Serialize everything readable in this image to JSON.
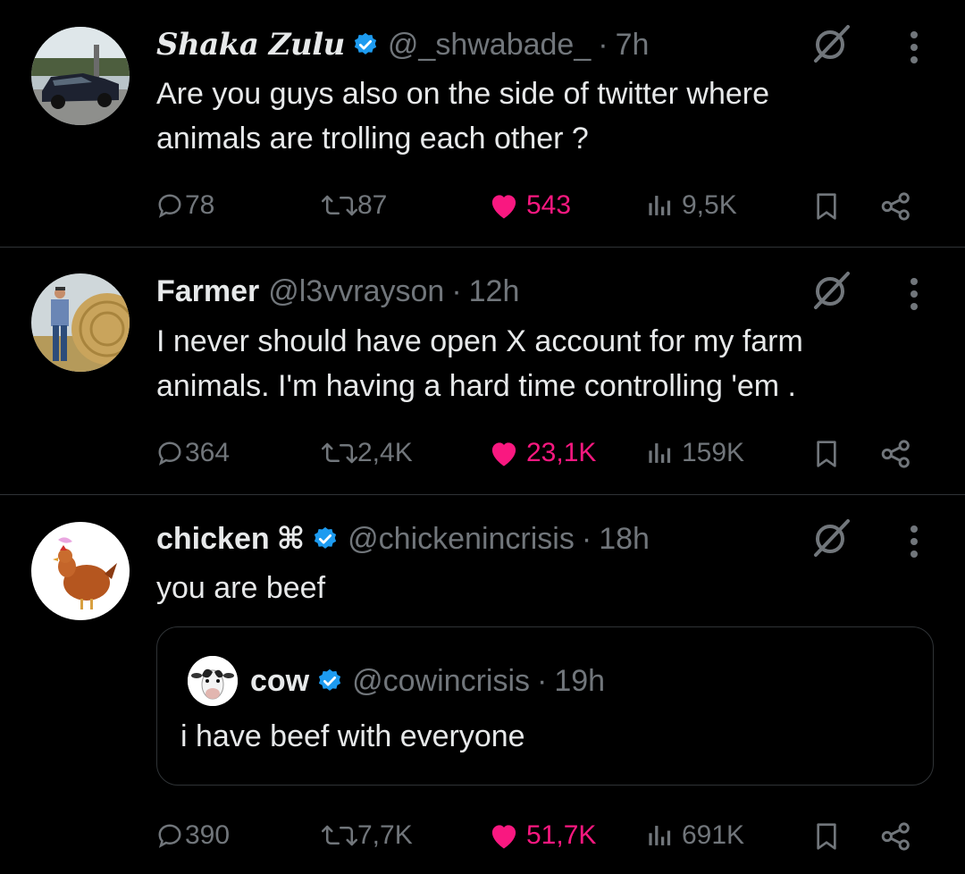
{
  "colors": {
    "background": "#000000",
    "text": "#e7e9ea",
    "muted": "#71767b",
    "like": "#f91880",
    "verified": "#1d9bf0",
    "divider": "#2f3336"
  },
  "tweets": [
    {
      "name": "Shaka Zulu",
      "verified": true,
      "handle": "@_shwabade_",
      "time": "7h",
      "text_lines": [
        "Are you guys also on the side of twitter where",
        "animals are trolling each other ?"
      ],
      "replies": "78",
      "reposts": "87",
      "likes": "543",
      "liked": true,
      "views": "9,5K",
      "avatar_icon": "car-avatar-icon"
    },
    {
      "name": "Farmer",
      "verified": false,
      "handle": "@l3vvrayson",
      "time": "12h",
      "text_lines": [
        "I never should have open X account for my farm",
        "animals. I'm having a hard time controlling 'em ."
      ],
      "replies": "364",
      "reposts": "2,4K",
      "likes": "23,1K",
      "liked": true,
      "views": "159K",
      "avatar_icon": "farmer-hay-avatar-icon"
    },
    {
      "name": "chicken",
      "name_suffix": "⌘",
      "verified": true,
      "handle": "@chickenincrisis",
      "time": "18h",
      "text_lines": [
        "you are beef"
      ],
      "replies": "390",
      "reposts": "7,7K",
      "likes": "51,7K",
      "liked": true,
      "views": "691K",
      "avatar_icon": "chicken-avatar-icon",
      "quote": {
        "name": "cow",
        "verified": true,
        "handle": "@cowincrisis",
        "time": "19h",
        "text": "i have beef with everyone",
        "avatar_icon": "cow-avatar-icon"
      }
    }
  ],
  "separator": "·"
}
